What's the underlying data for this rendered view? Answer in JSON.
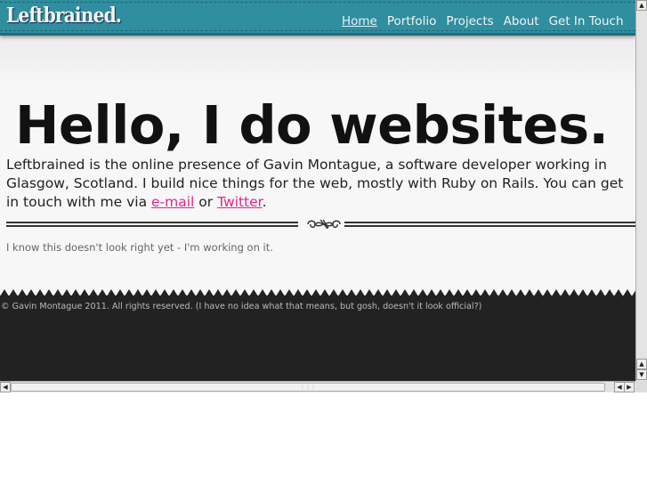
{
  "header": {
    "logo": "Leftbrained.",
    "nav": [
      {
        "label": "Home",
        "active": true
      },
      {
        "label": "Portfolio"
      },
      {
        "label": "Projects"
      },
      {
        "label": "About"
      },
      {
        "label": "Get In Touch"
      }
    ]
  },
  "main": {
    "title": "Hello, I do websites.",
    "intro_before": "Leftbrained is the online presence of Gavin Montague, a software developer working in Glasgow, Scotland. I build nice things for the web, mostly with Ruby on Rails. You can get in touch with me via ",
    "email_link": "e-mail",
    "intro_or": " or ",
    "twitter_link": "Twitter",
    "intro_end": ".",
    "note": "I know this doesn't look right yet - I'm working on it."
  },
  "footer": {
    "copyright": "© Gavin Montague 2011. All rights reserved. (I have no idea what that means, but gosh, doesn't it look official?)"
  },
  "colors": {
    "header": "#2f8e9f",
    "link": "#e0258f",
    "footer": "#222222"
  }
}
